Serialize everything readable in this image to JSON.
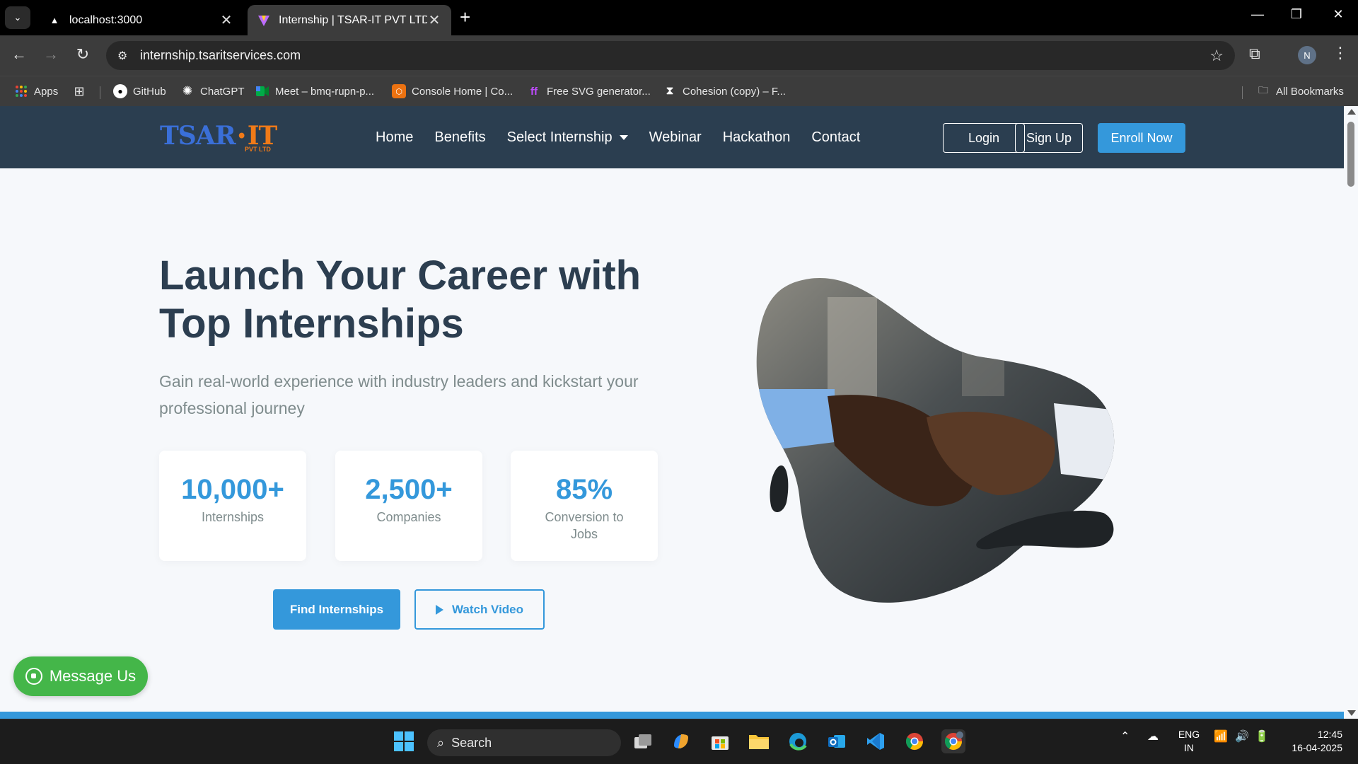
{
  "browser": {
    "tabs": [
      {
        "title": "localhost:3000",
        "close": "✕"
      },
      {
        "title": "Internship | TSAR-IT PVT LTD",
        "close": "✕"
      }
    ],
    "new_tab": "+",
    "url": "internship.tsaritservices.com",
    "profile_initial": "N",
    "bookmarks": [
      {
        "label": "Apps"
      },
      {
        "label": "GitHub"
      },
      {
        "label": "ChatGPT"
      },
      {
        "label": "Meet – bmq-rupn-p..."
      },
      {
        "label": "Console Home | Co..."
      },
      {
        "label": "Free SVG generator..."
      },
      {
        "label": "Cohesion (copy) – F..."
      }
    ],
    "all_bookmarks": "All Bookmarks"
  },
  "site": {
    "logo": {
      "main": "TSAR",
      "sep": "•",
      "accent": "IT",
      "sub": "PVT LTD"
    },
    "nav": {
      "items": [
        "Home",
        "Benefits",
        "Select Internship",
        "Webinar",
        "Hackathon",
        "Contact"
      ],
      "login": "Login",
      "signup": "Sign Up",
      "enroll": "Enroll Now"
    },
    "hero": {
      "title_line1": "Launch Your Career with",
      "title_line2": "Top Internships",
      "subtitle": "Gain real-world experience with industry leaders and kickstart your professional journey",
      "stats": [
        {
          "value": "10,000+",
          "label": "Internships"
        },
        {
          "value": "2,500+",
          "label": "Companies"
        },
        {
          "value": "85%",
          "label": "Conversion to Jobs"
        }
      ],
      "cta_primary": "Find Internships",
      "cta_secondary": "Watch Video"
    },
    "message_button": "Message Us",
    "colors": {
      "nav_bg": "#2b3e50",
      "accent": "#3498db",
      "heading": "#2c3e50",
      "whatsapp": "#44b649"
    }
  },
  "taskbar": {
    "search_label": "Search",
    "language": {
      "line1": "ENG",
      "line2": "IN"
    },
    "time": "12:45",
    "date": "16-04-2025"
  }
}
